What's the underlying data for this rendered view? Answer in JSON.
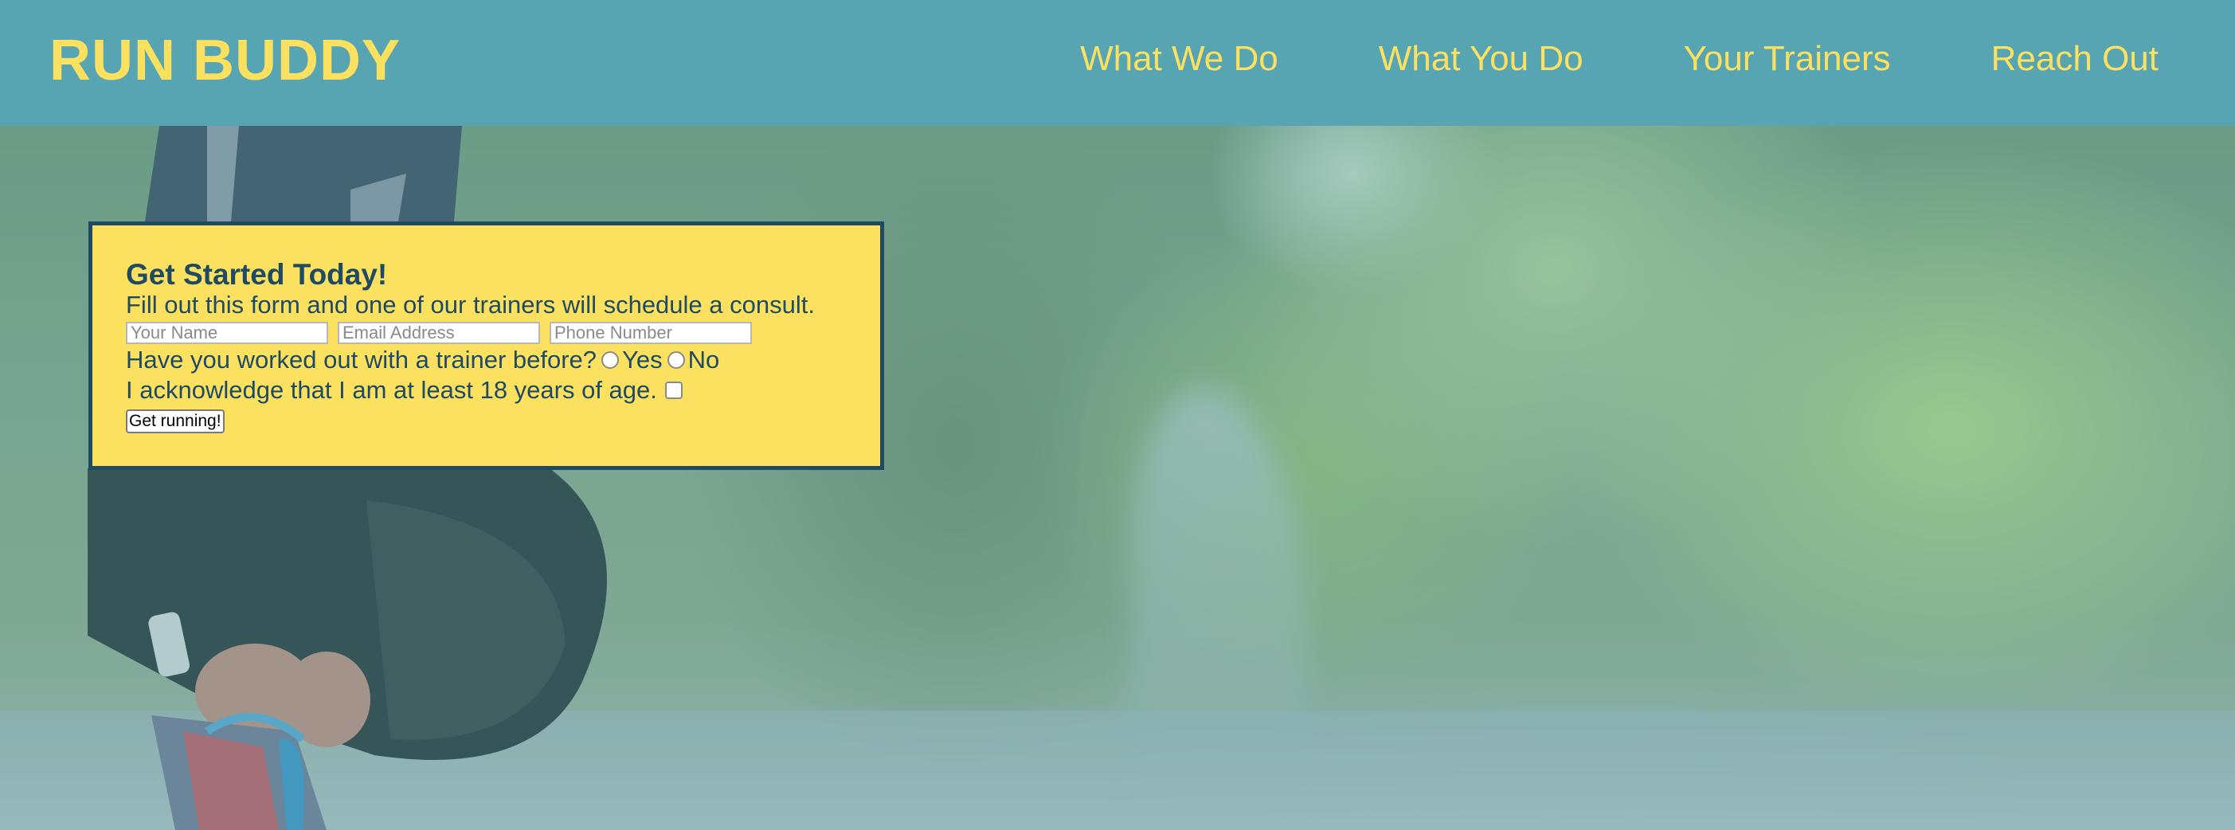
{
  "header": {
    "logo": "RUN BUDDY",
    "nav": [
      {
        "label": "What We Do"
      },
      {
        "label": "What You Do"
      },
      {
        "label": "Your Trainers"
      },
      {
        "label": "Reach Out"
      }
    ]
  },
  "form": {
    "title": "Get Started Today!",
    "description": "Fill out this form and one of our trainers will schedule a consult.",
    "name_placeholder": "Your Name",
    "email_placeholder": "Email Address",
    "phone_placeholder": "Phone Number",
    "trainer_question": "Have you worked out with a trainer before?",
    "yes_label": "Yes",
    "no_label": "No",
    "age_acknowledgement": "I acknowledge that I am at least 18 years of age.",
    "submit_label": "Get running!"
  },
  "colors": {
    "header_bg": "#57a5b3",
    "brand_yellow": "#fce05f",
    "form_border": "#1e4a63"
  }
}
